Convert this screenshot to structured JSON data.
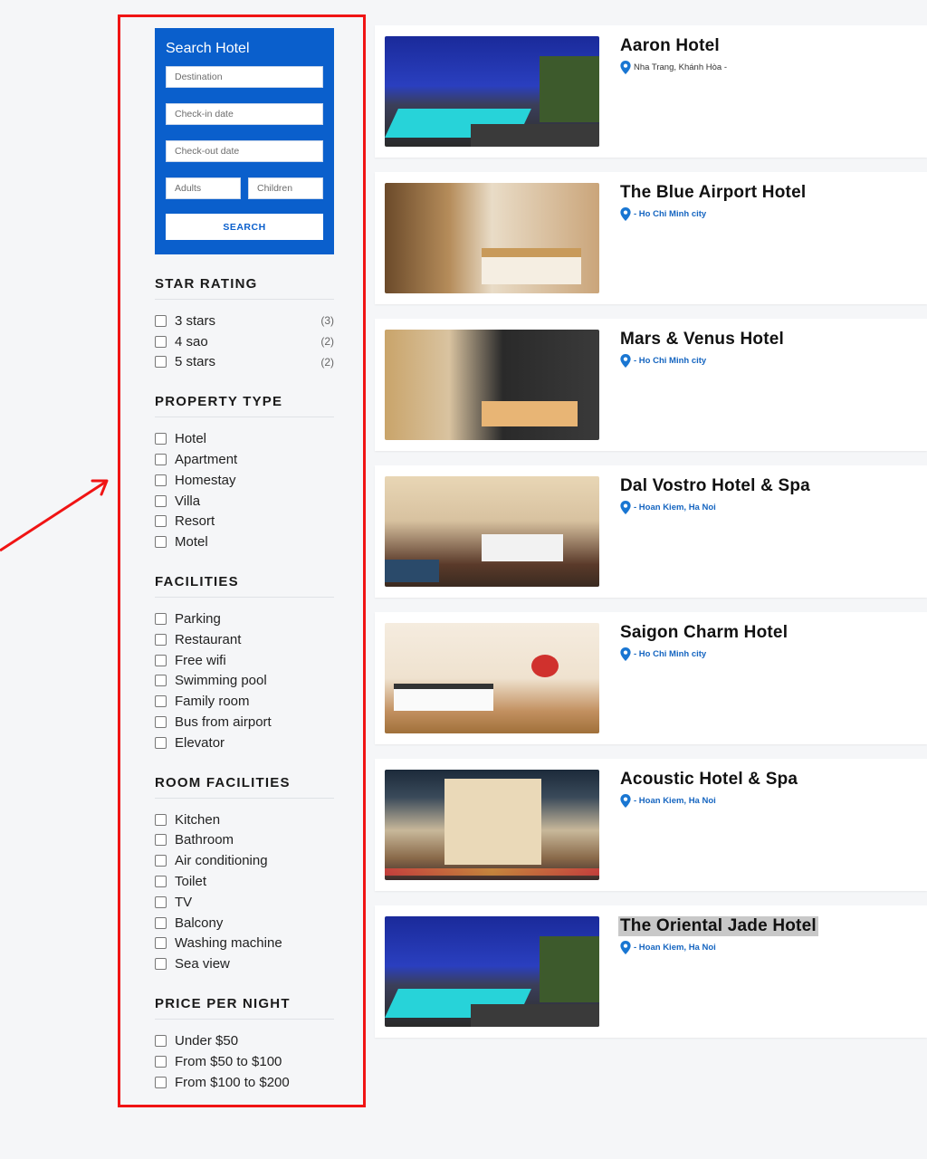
{
  "search": {
    "title": "Search Hotel",
    "destination_placeholder": "Destination",
    "checkin_placeholder": "Check-in date",
    "checkout_placeholder": "Check-out date",
    "adults_placeholder": "Adults",
    "children_placeholder": "Children",
    "button_label": "SEARCH"
  },
  "filters": {
    "star_rating": {
      "title": "STAR RATING",
      "items": [
        {
          "label": "3 stars",
          "count": "(3)"
        },
        {
          "label": "4 sao",
          "count": "(2)"
        },
        {
          "label": "5 stars",
          "count": "(2)"
        }
      ]
    },
    "property_type": {
      "title": "PROPERTY TYPE",
      "items": [
        {
          "label": "Hotel"
        },
        {
          "label": "Apartment"
        },
        {
          "label": "Homestay"
        },
        {
          "label": "Villa"
        },
        {
          "label": "Resort"
        },
        {
          "label": "Motel"
        }
      ]
    },
    "facilities": {
      "title": "FACILITIES",
      "items": [
        {
          "label": "Parking"
        },
        {
          "label": "Restaurant"
        },
        {
          "label": "Free wifi"
        },
        {
          "label": "Swimming pool"
        },
        {
          "label": "Family room"
        },
        {
          "label": "Bus from airport"
        },
        {
          "label": "Elevator"
        }
      ]
    },
    "room_facilities": {
      "title": "ROOM FACILITIES",
      "items": [
        {
          "label": "Kitchen"
        },
        {
          "label": "Bathroom"
        },
        {
          "label": "Air conditioning"
        },
        {
          "label": "Toilet"
        },
        {
          "label": "TV"
        },
        {
          "label": "Balcony"
        },
        {
          "label": "Washing machine"
        },
        {
          "label": "Sea view"
        }
      ]
    },
    "price": {
      "title": "PRICE PER NIGHT",
      "items": [
        {
          "label": "Under $50"
        },
        {
          "label": "From $50 to $100"
        },
        {
          "label": "From $100 to $200"
        }
      ]
    }
  },
  "hotels": [
    {
      "name": "Aaron Hotel",
      "location": "Nha Trang, Khánh Hòa -",
      "image": "rooftop-pool-night"
    },
    {
      "name": "The Blue Airport Hotel",
      "location": "- Ho Chi Minh city",
      "image": "hotel-room"
    },
    {
      "name": "Mars & Venus Hotel",
      "location": "- Ho Chi Minh city",
      "image": "hotel-lobby"
    },
    {
      "name": "Dal Vostro Hotel & Spa",
      "location": "- Hoan Kiem, Ha Noi",
      "image": "hotel-room"
    },
    {
      "name": "Saigon Charm Hotel",
      "location": "- Ho Chi Minh city",
      "image": "hotel-room"
    },
    {
      "name": "Acoustic Hotel & Spa",
      "location": "- Hoan Kiem, Ha Noi",
      "image": "hotel-exterior-night"
    },
    {
      "name": "The Oriental Jade Hotel",
      "location": "- Hoan Kiem, Ha Noi",
      "image": "rooftop-pool-night"
    }
  ],
  "colors": {
    "brand_blue": "#0a5fcc",
    "location_blue": "#1565c0",
    "annotation_red": "#f01414"
  }
}
